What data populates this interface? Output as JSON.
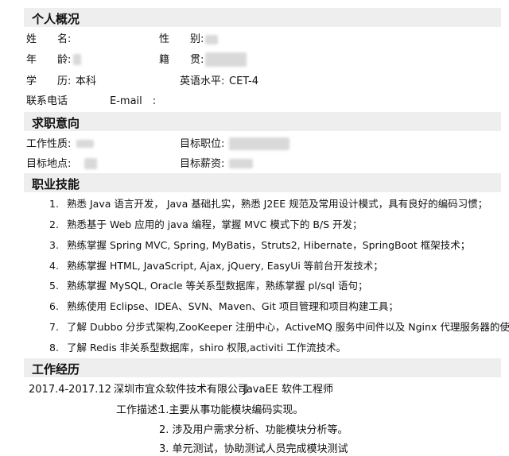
{
  "colors": {
    "section_bg": "#eeeeee",
    "redacted": "#d9d9d9"
  },
  "sections": {
    "personal": "个人概况",
    "intent": "求职意向",
    "skills": "职业技能",
    "experience": "工作经历"
  },
  "personal": {
    "name_label": "姓　　名:",
    "gender_label": "性　　别:",
    "age_label": "年　　龄:",
    "native_label": "籍　　贯:",
    "education_label": "学　　历:",
    "education_value": "本科",
    "english_label": "英语水平:",
    "english_value": "CET-4",
    "phone_label": "联系电话",
    "email_label": "E-mail　:"
  },
  "intent": {
    "nature_label": "工作性质:",
    "position_label": "目标职位:",
    "location_label": "目标地点:",
    "salary_label": "目标薪资:"
  },
  "skills": [
    {
      "num": "1.",
      "text": "熟悉 Java 语言开发， Java 基础扎实，熟悉 J2EE 规范及常用设计模式，具有良好的编码习惯；"
    },
    {
      "num": "2.",
      "text": "熟悉基于 Web 应用的 java 编程，掌握 MVC 模式下的 B/S 开发；"
    },
    {
      "num": "3.",
      "text": "熟练掌握 Spring MVC, Spring, MyBatis，Struts2, Hibernate，SpringBoot 框架技术；"
    },
    {
      "num": "4.",
      "text": "熟练掌握 HTML, JavaScript, Ajax, jQuery, EasyUi 等前台开发技术；"
    },
    {
      "num": "5.",
      "text": "熟练掌握 MySQL, Oracle 等关系型数据库，熟练掌握 pl/sql 语句；"
    },
    {
      "num": "6.",
      "text": "熟练使用 Eclipse、IDEA、SVN、Maven、Git 项目管理和项目构建工具；"
    },
    {
      "num": "7.",
      "text": "了解 Dubbo 分步式架构,ZooKeeper 注册中心，ActiveMQ 服务中间件以及 Nginx 代理服务器的使用；"
    },
    {
      "num": "8.",
      "text": "了解 Redis 非关系型数据库，shiro 权限,activiti 工作流技术。"
    }
  ],
  "experience": {
    "period": "2017.4-2017.12",
    "company": "深圳市宜众软件技术有限公司",
    "title": "JavaEE 软件工程师",
    "desc_label": "工作描述:",
    "items": [
      "1.主要从事功能模块编码实现。",
      "2. 涉及用户需求分析、功能模块分析等。",
      "3. 单元测试，协助测试人员完成模块测试"
    ]
  }
}
